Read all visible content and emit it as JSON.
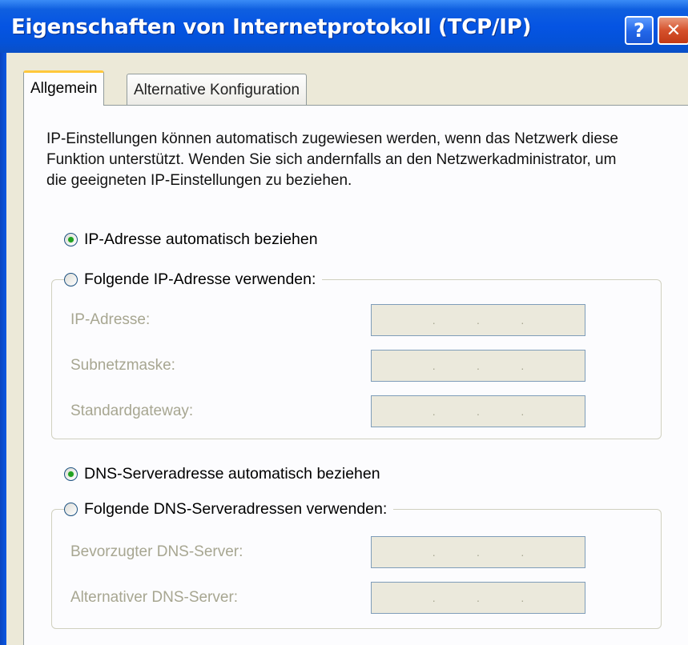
{
  "window": {
    "title": "Eigenschaften von Internetprotokoll (TCP/IP)",
    "help_glyph": "?",
    "close_glyph": "✕"
  },
  "tabs": [
    {
      "label": "Allgemein",
      "active": true
    },
    {
      "label": "Alternative Konfiguration",
      "active": false
    }
  ],
  "description": "IP-Einstellungen können automatisch zugewiesen werden, wenn das Netzwerk diese Funktion unterstützt. Wenden Sie sich andernfalls an den Netzwerkadministrator, um die geeigneten IP-Einstellungen zu beziehen.",
  "ip_section": {
    "auto_label": "IP-Adresse automatisch beziehen",
    "auto_checked": true,
    "manual_label": "Folgende IP-Adresse verwenden:",
    "manual_checked": false,
    "fields": [
      {
        "label": "IP-Adresse:",
        "dots": [
          ".",
          ".",
          "."
        ]
      },
      {
        "label": "Subnetzmaske:",
        "dots": [
          ".",
          ".",
          "."
        ]
      },
      {
        "label": "Standardgateway:",
        "dots": [
          ".",
          ".",
          "."
        ]
      }
    ]
  },
  "dns_section": {
    "auto_label": "DNS-Serveradresse automatisch beziehen",
    "auto_checked": true,
    "manual_label": "Folgende DNS-Serveradressen verwenden:",
    "manual_checked": false,
    "fields": [
      {
        "label": "Bevorzugter DNS-Server:",
        "dots": [
          ".",
          ".",
          "."
        ]
      },
      {
        "label": "Alternativer DNS-Server:",
        "dots": [
          ".",
          ".",
          "."
        ]
      }
    ]
  },
  "colors": {
    "title_bar": "#0554e3",
    "dialog_bg": "#ece9d8",
    "panel_bg": "#fcfcfe",
    "radio_check": "#21a121",
    "tab_highlight": "#ffc83c",
    "disabled_text": "#a7a691"
  }
}
